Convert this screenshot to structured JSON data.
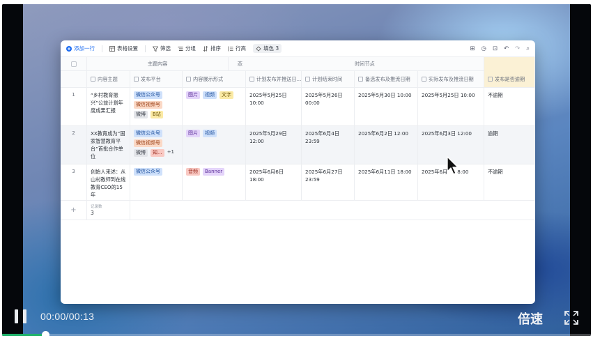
{
  "player": {
    "time": "00:00/00:13",
    "speed_label": "倍速",
    "progress_fraction": 0.0
  },
  "toolbar": {
    "add_row": "添加一行",
    "table_settings": "表格设置",
    "filter": "筛选",
    "group": "分组",
    "sort": "排序",
    "row_height": "行高",
    "color": "填色 3"
  },
  "groups": {
    "topic": "主题内容",
    "time": "时间节点"
  },
  "columns": {
    "topic": "内容主题",
    "platform": "发布平台",
    "format": "内容展示形式",
    "planned_start": "计划发布并推送日...",
    "planned_end": "计划结束时间",
    "backup_date": "备选发布及推流日期",
    "actual_date": "实际发布及推流日期",
    "overdue": "发布是否逾期"
  },
  "rows": [
    {
      "num": "1",
      "topic": "“乡村教育振兴”公益计划年度成果汇报",
      "platforms": [
        "微信公众号",
        "微信视频号",
        "微博",
        "B站"
      ],
      "platform_more": "",
      "formats": [
        "图片",
        "视频",
        "文字"
      ],
      "planned_start": "2025年5月25日 10:00",
      "planned_end": "2025年5月26日 00:00",
      "backup_date": "2025年5月30日 10:00",
      "actual_date": "2025年5月25日 10:00",
      "overdue": "不逾期"
    },
    {
      "num": "2",
      "topic": "XX教育成为“国家智慧教育平台”首批合作单位",
      "platforms": [
        "微信公众号",
        "微信视频号",
        "微博",
        "知..."
      ],
      "platform_more": "+1",
      "formats": [
        "图片",
        "视频"
      ],
      "planned_start": "2025年5月29日 12:00",
      "planned_end": "2025年6月4日 23:59",
      "backup_date": "2025年6月2日 12:00",
      "actual_date": "2025年6月3日 12:00",
      "overdue": "逾期"
    },
    {
      "num": "3",
      "topic": "创始人来述：从山村教师到在线教育CEO的15年",
      "platforms": [
        "微信公众号"
      ],
      "platform_more": "",
      "formats": [
        "音频",
        "Banner"
      ],
      "planned_start": "2025年6月6日 18:00",
      "planned_end": "2025年6月27日 23:59",
      "backup_date": "2025年6月11日 18:00",
      "actual_date": "2025年6月",
      "actual_date_tail": "8:00",
      "overdue": "不逾期"
    }
  ],
  "footer": {
    "count_label": "记录数",
    "count": "3",
    "add_icon": "+"
  },
  "stray_text": "态",
  "icons": {
    "add": "plus-circle-icon",
    "settings": "table-settings-icon",
    "filter": "filter-icon",
    "group": "group-icon",
    "sort": "sort-icon",
    "row_height": "row-height-icon",
    "color": "paint-bucket-icon",
    "pause": "pause-icon",
    "fullscreen": "fullscreen-icon",
    "cursor": "mouse-pointer-icon"
  },
  "colors": {
    "accent": "#1f6ef2",
    "progress": "#20b26b",
    "highlight_column": "#fbf1d5"
  }
}
